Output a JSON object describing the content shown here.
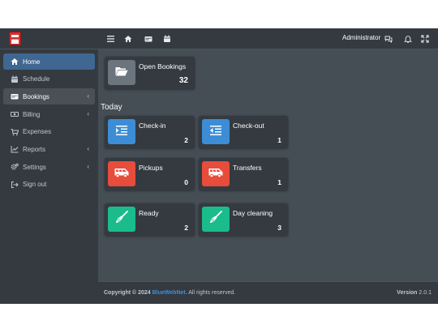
{
  "colors": {
    "sidebar_bg": "#343a40",
    "content_bg": "#454d55",
    "active_nav": "#3f6791",
    "info": "#3c8dd6",
    "danger": "#e74c3c",
    "success": "#1abc8c",
    "secondary": "#6c757d"
  },
  "brand": {
    "logo_icon": "app-logo"
  },
  "sidebar": {
    "items": [
      {
        "label": "Home",
        "icon": "home-icon",
        "state": "active"
      },
      {
        "label": "Schedule",
        "icon": "calendar-icon"
      },
      {
        "label": "Bookings",
        "icon": "id-card-icon",
        "state": "open",
        "has_children": true
      },
      {
        "label": "Billing",
        "icon": "money-icon",
        "has_children": true
      },
      {
        "label": "Expenses",
        "icon": "cart-icon"
      },
      {
        "label": "Reports",
        "icon": "chart-line-icon",
        "has_children": true
      },
      {
        "label": "Settings",
        "icon": "cogs-icon",
        "has_children": true
      },
      {
        "label": "Sign out",
        "icon": "sign-out-icon"
      }
    ]
  },
  "topbar": {
    "left_icons": [
      "menu-icon",
      "home-icon",
      "id-card-icon",
      "calendar-icon"
    ],
    "user": "Administrator",
    "right_icons": [
      "comments-icon",
      "bell-icon",
      "expand-icon"
    ]
  },
  "open_bookings": {
    "label": "Open Bookings",
    "value": "32",
    "icon": "folder-open-icon"
  },
  "today": {
    "title": "Today",
    "cards": [
      {
        "label": "Check-in",
        "value": "2",
        "icon": "indent-icon",
        "color": "info"
      },
      {
        "label": "Check-out",
        "value": "1",
        "icon": "outdent-icon",
        "color": "info"
      },
      {
        "label": "Pickups",
        "value": "0",
        "icon": "shuttle-van-icon",
        "color": "danger"
      },
      {
        "label": "Transfers",
        "value": "1",
        "icon": "shuttle-van-icon",
        "color": "danger"
      },
      {
        "label": "Ready",
        "value": "2",
        "icon": "broom-icon",
        "color": "success"
      },
      {
        "label": "Day cleaning",
        "value": "3",
        "icon": "broom-icon",
        "color": "success"
      }
    ]
  },
  "footer": {
    "copyright_prefix": "Copyright © 2024",
    "company": "BlueWebNet.",
    "rights": "All rights reserved.",
    "version_label": "Version",
    "version": "2.0.1"
  }
}
